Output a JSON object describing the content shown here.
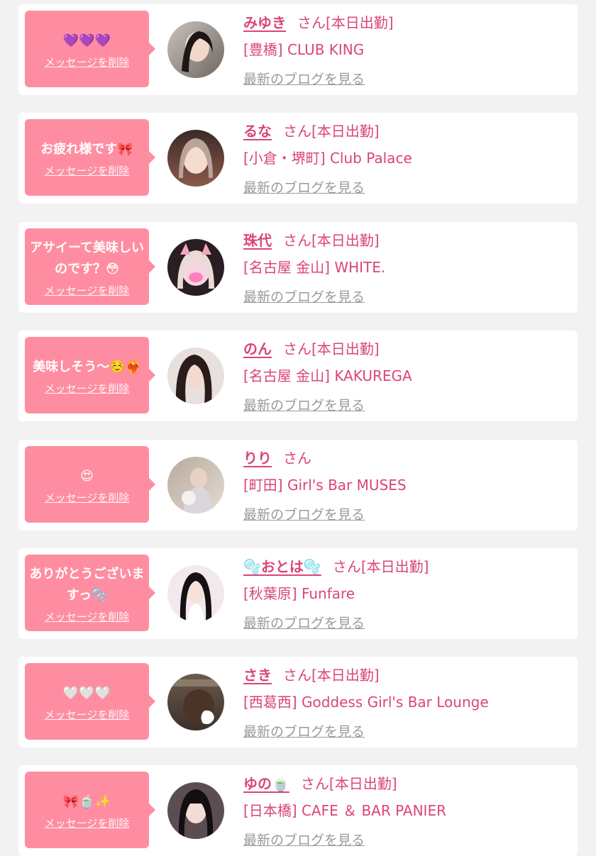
{
  "delete_label": "メッセージを削除",
  "blog_label": "最新のブログを見る",
  "honorific": "さん",
  "colors": {
    "background": "#f2f2f2",
    "bubble": "#ff8da1",
    "accent_text": "#d94674",
    "muted_text": "#9a9a9a"
  },
  "messages": [
    {
      "text": "💜💜💜",
      "name": "みゆき",
      "status": "[本日出勤]",
      "shop": "[豊橋] CLUB KING",
      "avatar": "avatar-photo"
    },
    {
      "text": "お疲れ様です🎀",
      "name": "るな",
      "status": "[本日出勤]",
      "shop": "[小倉・堺町] Club Palace",
      "avatar": "avatar-photo"
    },
    {
      "text": "アサイーて美味しいのです？😳",
      "name": "珠代",
      "status": "[本日出勤]",
      "shop": "[名古屋 金山] WHITE.",
      "avatar": "avatar-photo"
    },
    {
      "text": "美味しそう〜☺️❤️‍🔥",
      "name": "のん",
      "status": "[本日出勤]",
      "shop": "[名古屋 金山] KAKUREGA",
      "avatar": "avatar-photo"
    },
    {
      "text": "😍",
      "name": "りり",
      "status": "",
      "shop": "[町田] Girl's Bar MUSES",
      "avatar": "avatar-photo"
    },
    {
      "text": "ありがとうございますっ🫧",
      "name": "🫧おとは🫧",
      "status": "[本日出勤]",
      "shop": "[秋葉原] Funfare",
      "avatar": "avatar-photo"
    },
    {
      "text": "🤍🤍🤍",
      "name": "さき",
      "status": "[本日出勤]",
      "shop": "[西葛西] Goddess Girl's Bar Lounge",
      "avatar": "avatar-photo"
    },
    {
      "text": "🎀🍵✨",
      "name": "ゆの🍵",
      "status": "[本日出勤]",
      "shop": "[日本橋] CAFE ＆ BAR PANIER",
      "avatar": "avatar-photo"
    }
  ]
}
